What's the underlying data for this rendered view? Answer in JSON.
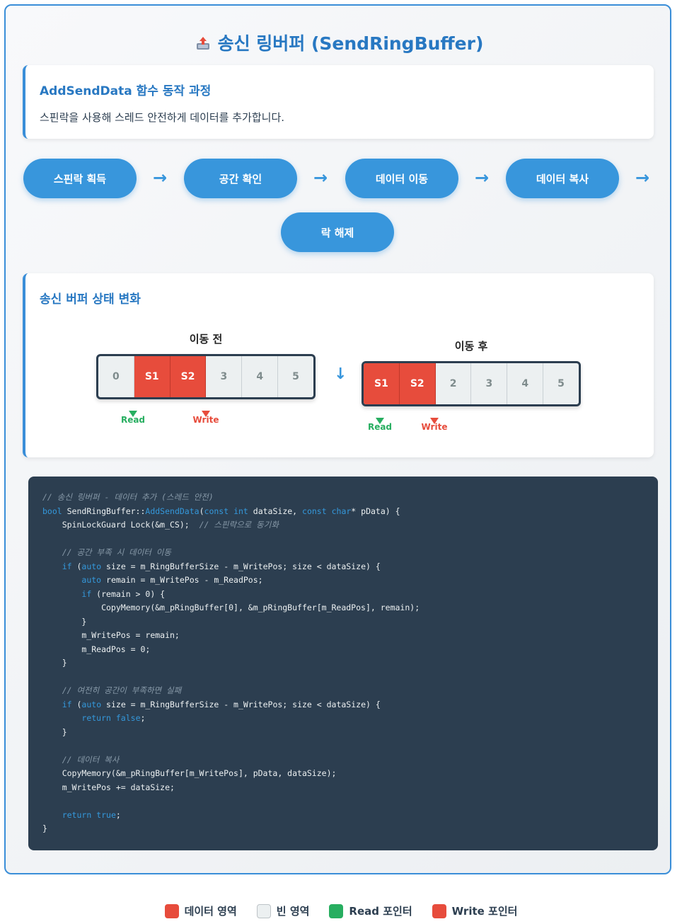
{
  "title": "송신 링버퍼 (SendRingBuffer)",
  "title_icon": "outbox-tray-icon",
  "intro": {
    "heading": "AddSendData 함수 동작 과정",
    "text": "스핀락을 사용해 스레드 안전하게 데이터를 추가합니다."
  },
  "steps": [
    "스핀락 획득",
    "공간 확인",
    "데이터 이동",
    "데이터 복사",
    "락 해제"
  ],
  "state": {
    "heading": "송신 버퍼 상태 변화",
    "before": {
      "label": "이동 전",
      "cells": [
        "0",
        "S1",
        "S2",
        "3",
        "4",
        "5"
      ]
    },
    "after": {
      "label": "이동 후",
      "cells": [
        "S1",
        "S2",
        "2",
        "3",
        "4",
        "5"
      ]
    },
    "read_label": "Read",
    "write_label": "Write",
    "down_arrow": "↓"
  },
  "code": "",
  "legend": {
    "data": "데이터 영역",
    "empty": "빈 영역",
    "read": "Read 포인터",
    "write": "Write 포인터"
  },
  "colors": {
    "accent": "#3a8ed8",
    "data": "#e74c3c",
    "empty": "#ecf0f1",
    "read": "#27ae60",
    "write": "#e74c3c",
    "code_bg": "#2c3e50"
  }
}
